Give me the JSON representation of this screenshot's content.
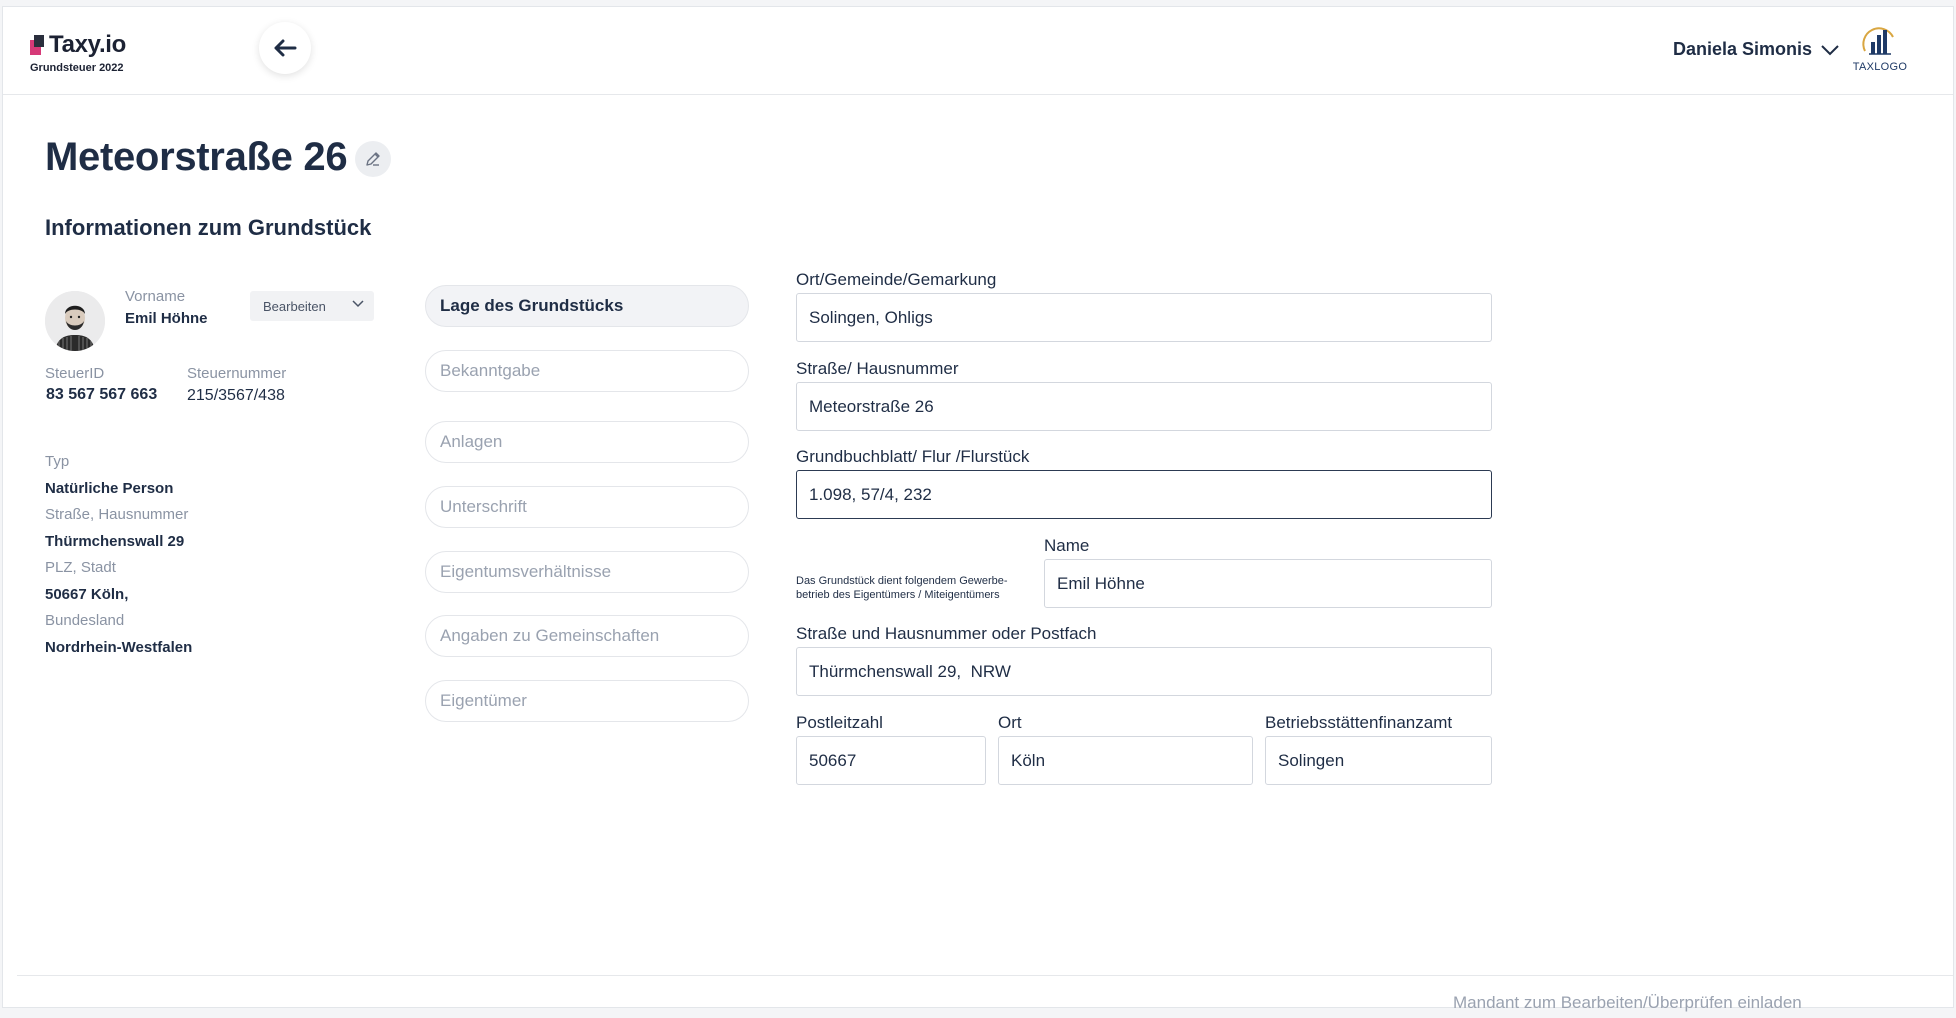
{
  "header": {
    "brand_name": "Taxy.io",
    "brand_sub": "Grundsteuer 2022",
    "user_name": "Daniela Simonis",
    "tax_logo_text": "TAXLOGO"
  },
  "page": {
    "title": "Meteorstraße 26",
    "section_title": "Informationen zum Grundstück"
  },
  "client": {
    "vorname_label": "Vorname",
    "vorname_value": "Emil Höhne",
    "edit_label": "Bearbeiten",
    "steuerid_label": "SteuerID",
    "steuerid_value": "83 567 567 663",
    "steuernummer_label": "Steuernummer",
    "steuernummer_value": "215/3567/438",
    "typ_label": "Typ",
    "typ_value": "Natürliche Person",
    "strasse_label": "Straße, Hausnummer",
    "strasse_value": "Thürmchenswall 29",
    "plz_label": "PLZ, Stadt",
    "plz_value": "50667 Köln,",
    "bundesland_label": "Bundesland",
    "bundesland_value": "Nordrhein-Westfalen"
  },
  "nav": [
    {
      "label": "Lage des Grundstücks",
      "active": true
    },
    {
      "label": "Bekanntgabe",
      "active": false
    },
    {
      "label": "Anlagen",
      "active": false
    },
    {
      "label": "Unterschrift",
      "active": false
    },
    {
      "label": "Eigentumsverhältnisse",
      "active": false
    },
    {
      "label": "Angaben zu Gemeinschaften",
      "active": false
    },
    {
      "label": "Eigentümer",
      "active": false
    }
  ],
  "form": {
    "ort_label": "Ort/Gemeinde/Gemarkung",
    "ort_value": "Solingen, Ohligs",
    "strasse_label": "Straße/ Hausnummer",
    "strasse_value": "Meteorstraße 26",
    "grundbuch_label": "Grundbuchblatt/ Flur /Flurstück",
    "grundbuch_value": "1.098, 57/4, 232",
    "gewerbe_note": "Das Grundstück dient folgendem Gewerbe-betrieb des Eigentümers / Miteigentümers",
    "name_label": "Name",
    "name_value": "Emil Höhne",
    "postfach_label": "Straße und Hausnummer oder Postfach",
    "postfach_value": "Thürmchenswall 29,  NRW",
    "plz_label": "Postleitzahl",
    "plz_value": "50667",
    "ort2_label": "Ort",
    "ort2_value": "Köln",
    "finanzamt_label": "Betriebsstättenfinanzamt",
    "finanzamt_value": "Solingen"
  },
  "footer": {
    "invite_link": "Mandant zum Bearbeiten/Überprüfen einladen"
  }
}
